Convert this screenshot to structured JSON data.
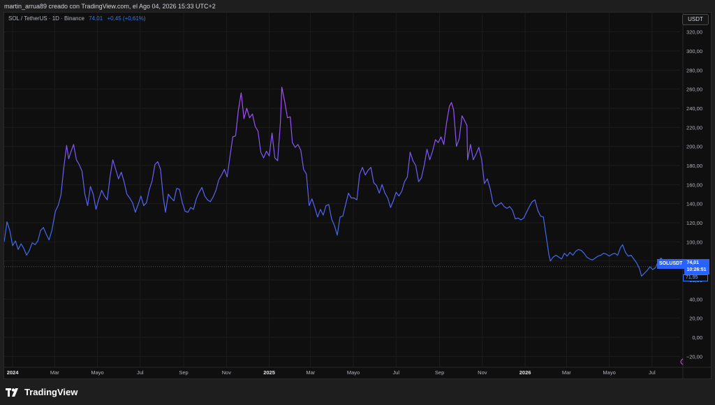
{
  "caption": "martin_arrua89 creado con TradingView.com, el Ago 04, 2026 15:33 UTC+2",
  "legend": {
    "symbol": "SOL / TetherUS · 1D · Binance",
    "price": "74,01",
    "change": "+0,45 (+0,61%)"
  },
  "currency_button": "USDT",
  "price_tag": {
    "symbol": "SOLUSDT",
    "price": "74,01",
    "countdown": "10:26:51",
    "low": "71,95"
  },
  "logo_text": "TradingView",
  "colors": {
    "background": "#0f0f0f",
    "line_low": "#3b6cf0",
    "line_high": "#a64dff",
    "accent": "#2962ff"
  },
  "chart_data": {
    "type": "line",
    "ylim": [
      -30,
      330
    ],
    "y_ticks": [
      -20,
      0,
      20,
      40,
      60,
      80,
      100,
      120,
      140,
      160,
      180,
      200,
      220,
      240,
      260,
      280,
      300,
      320
    ],
    "y_tick_labels": [
      "−20,00",
      "0,00",
      "20,00",
      "40,00",
      "60,00",
      "80,00",
      "100,00",
      "120,00",
      "140,00",
      "160,00",
      "180,00",
      "200,00",
      "220,00",
      "240,00",
      "260,00",
      "280,00",
      "300,00",
      "320,00"
    ],
    "x_labels": [
      {
        "label": "2024",
        "date": "2024-01-01",
        "bold": true
      },
      {
        "label": "Mar",
        "date": "2024-03-01",
        "bold": false
      },
      {
        "label": "Mayo",
        "date": "2024-05-01",
        "bold": false
      },
      {
        "label": "Jul",
        "date": "2024-07-01",
        "bold": false
      },
      {
        "label": "Sep",
        "date": "2024-09-01",
        "bold": false
      },
      {
        "label": "Nov",
        "date": "2024-11-01",
        "bold": false
      },
      {
        "label": "2025",
        "date": "2025-01-01",
        "bold": true
      },
      {
        "label": "Mar",
        "date": "2025-03-01",
        "bold": false
      },
      {
        "label": "Mayo",
        "date": "2025-05-01",
        "bold": false
      },
      {
        "label": "Jul",
        "date": "2025-07-01",
        "bold": false
      },
      {
        "label": "Sep",
        "date": "2025-09-01",
        "bold": false
      },
      {
        "label": "Nov",
        "date": "2025-11-01",
        "bold": false
      },
      {
        "label": "2026",
        "date": "2026-01-01",
        "bold": true
      },
      {
        "label": "Mar",
        "date": "2026-03-01",
        "bold": false
      },
      {
        "label": "Mayo",
        "date": "2026-05-01",
        "bold": false
      },
      {
        "label": "Jul",
        "date": "2026-07-01",
        "bold": false
      }
    ],
    "x_range": [
      "2023-12-20",
      "2026-08-10"
    ],
    "last_price": 74.01,
    "series": [
      {
        "points": [
          [
            "2023-12-20",
            100
          ],
          [
            "2023-12-24",
            121
          ],
          [
            "2023-12-28",
            112
          ],
          [
            "2024-01-01",
            96
          ],
          [
            "2024-01-05",
            101
          ],
          [
            "2024-01-09",
            92
          ],
          [
            "2024-01-13",
            98
          ],
          [
            "2024-01-17",
            93
          ],
          [
            "2024-01-21",
            86
          ],
          [
            "2024-01-25",
            91
          ],
          [
            "2024-01-29",
            99
          ],
          [
            "2024-02-02",
            97
          ],
          [
            "2024-02-06",
            101
          ],
          [
            "2024-02-10",
            112
          ],
          [
            "2024-02-14",
            115
          ],
          [
            "2024-02-18",
            108
          ],
          [
            "2024-02-22",
            102
          ],
          [
            "2024-02-26",
            112
          ],
          [
            "2024-03-02",
            132
          ],
          [
            "2024-03-06",
            138
          ],
          [
            "2024-03-10",
            149
          ],
          [
            "2024-03-14",
            178
          ],
          [
            "2024-03-18",
            201
          ],
          [
            "2024-03-21",
            187
          ],
          [
            "2024-03-24",
            194
          ],
          [
            "2024-03-28",
            202
          ],
          [
            "2024-04-01",
            186
          ],
          [
            "2024-04-05",
            181
          ],
          [
            "2024-04-09",
            174
          ],
          [
            "2024-04-13",
            150
          ],
          [
            "2024-04-17",
            138
          ],
          [
            "2024-04-21",
            158
          ],
          [
            "2024-04-25",
            150
          ],
          [
            "2024-04-29",
            134
          ],
          [
            "2024-05-03",
            145
          ],
          [
            "2024-05-07",
            154
          ],
          [
            "2024-05-11",
            148
          ],
          [
            "2024-05-15",
            144
          ],
          [
            "2024-05-19",
            168
          ],
          [
            "2024-05-23",
            186
          ],
          [
            "2024-05-27",
            176
          ],
          [
            "2024-05-31",
            166
          ],
          [
            "2024-06-04",
            173
          ],
          [
            "2024-06-08",
            163
          ],
          [
            "2024-06-12",
            150
          ],
          [
            "2024-06-16",
            146
          ],
          [
            "2024-06-20",
            141
          ],
          [
            "2024-06-24",
            131
          ],
          [
            "2024-06-28",
            139
          ],
          [
            "2024-07-02",
            148
          ],
          [
            "2024-07-06",
            138
          ],
          [
            "2024-07-10",
            141
          ],
          [
            "2024-07-14",
            155
          ],
          [
            "2024-07-18",
            164
          ],
          [
            "2024-07-22",
            181
          ],
          [
            "2024-07-26",
            184
          ],
          [
            "2024-07-30",
            176
          ],
          [
            "2024-08-03",
            146
          ],
          [
            "2024-08-06",
            131
          ],
          [
            "2024-08-10",
            150
          ],
          [
            "2024-08-14",
            146
          ],
          [
            "2024-08-18",
            143
          ],
          [
            "2024-08-22",
            156
          ],
          [
            "2024-08-26",
            155
          ],
          [
            "2024-08-30",
            141
          ],
          [
            "2024-09-03",
            132
          ],
          [
            "2024-09-07",
            131
          ],
          [
            "2024-09-11",
            136
          ],
          [
            "2024-09-15",
            134
          ],
          [
            "2024-09-19",
            145
          ],
          [
            "2024-09-23",
            152
          ],
          [
            "2024-09-27",
            157
          ],
          [
            "2024-10-01",
            148
          ],
          [
            "2024-10-05",
            144
          ],
          [
            "2024-10-09",
            142
          ],
          [
            "2024-10-13",
            147
          ],
          [
            "2024-10-17",
            154
          ],
          [
            "2024-10-21",
            165
          ],
          [
            "2024-10-25",
            170
          ],
          [
            "2024-10-29",
            176
          ],
          [
            "2024-11-02",
            168
          ],
          [
            "2024-11-06",
            189
          ],
          [
            "2024-11-10",
            210
          ],
          [
            "2024-11-14",
            211
          ],
          [
            "2024-11-18",
            238
          ],
          [
            "2024-11-22",
            256
          ],
          [
            "2024-11-26",
            229
          ],
          [
            "2024-11-30",
            240
          ],
          [
            "2024-12-04",
            230
          ],
          [
            "2024-12-08",
            234
          ],
          [
            "2024-12-12",
            221
          ],
          [
            "2024-12-16",
            216
          ],
          [
            "2024-12-20",
            194
          ],
          [
            "2024-12-24",
            188
          ],
          [
            "2024-12-28",
            195
          ],
          [
            "2025-01-01",
            190
          ],
          [
            "2025-01-05",
            214
          ],
          [
            "2025-01-09",
            188
          ],
          [
            "2025-01-13",
            185
          ],
          [
            "2025-01-17",
            225
          ],
          [
            "2025-01-19",
            262
          ],
          [
            "2025-01-23",
            247
          ],
          [
            "2025-01-27",
            230
          ],
          [
            "2025-01-31",
            231
          ],
          [
            "2025-02-03",
            204
          ],
          [
            "2025-02-07",
            199
          ],
          [
            "2025-02-11",
            202
          ],
          [
            "2025-02-15",
            196
          ],
          [
            "2025-02-19",
            176
          ],
          [
            "2025-02-23",
            171
          ],
          [
            "2025-02-27",
            138
          ],
          [
            "2025-03-03",
            145
          ],
          [
            "2025-03-07",
            136
          ],
          [
            "2025-03-11",
            126
          ],
          [
            "2025-03-15",
            134
          ],
          [
            "2025-03-19",
            128
          ],
          [
            "2025-03-23",
            138
          ],
          [
            "2025-03-27",
            139
          ],
          [
            "2025-03-31",
            124
          ],
          [
            "2025-04-04",
            117
          ],
          [
            "2025-04-08",
            107
          ],
          [
            "2025-04-12",
            126
          ],
          [
            "2025-04-16",
            127
          ],
          [
            "2025-04-20",
            139
          ],
          [
            "2025-04-24",
            151
          ],
          [
            "2025-04-28",
            146
          ],
          [
            "2025-05-02",
            146
          ],
          [
            "2025-05-06",
            144
          ],
          [
            "2025-05-10",
            171
          ],
          [
            "2025-05-14",
            178
          ],
          [
            "2025-05-18",
            170
          ],
          [
            "2025-05-22",
            175
          ],
          [
            "2025-05-26",
            178
          ],
          [
            "2025-05-30",
            162
          ],
          [
            "2025-06-03",
            159
          ],
          [
            "2025-06-07",
            151
          ],
          [
            "2025-06-11",
            160
          ],
          [
            "2025-06-15",
            151
          ],
          [
            "2025-06-19",
            146
          ],
          [
            "2025-06-23",
            136
          ],
          [
            "2025-06-27",
            143
          ],
          [
            "2025-07-01",
            152
          ],
          [
            "2025-07-05",
            148
          ],
          [
            "2025-07-09",
            153
          ],
          [
            "2025-07-13",
            163
          ],
          [
            "2025-07-17",
            168
          ],
          [
            "2025-07-21",
            194
          ],
          [
            "2025-07-25",
            185
          ],
          [
            "2025-07-29",
            180
          ],
          [
            "2025-08-02",
            163
          ],
          [
            "2025-08-06",
            167
          ],
          [
            "2025-08-10",
            180
          ],
          [
            "2025-08-14",
            197
          ],
          [
            "2025-08-18",
            186
          ],
          [
            "2025-08-22",
            195
          ],
          [
            "2025-08-26",
            207
          ],
          [
            "2025-08-30",
            204
          ],
          [
            "2025-09-03",
            210
          ],
          [
            "2025-09-07",
            202
          ],
          [
            "2025-09-11",
            225
          ],
          [
            "2025-09-15",
            242
          ],
          [
            "2025-09-18",
            246
          ],
          [
            "2025-09-21",
            238
          ],
          [
            "2025-09-25",
            200
          ],
          [
            "2025-09-29",
            208
          ],
          [
            "2025-10-03",
            232
          ],
          [
            "2025-10-06",
            228
          ],
          [
            "2025-10-10",
            222
          ],
          [
            "2025-10-11",
            186
          ],
          [
            "2025-10-15",
            202
          ],
          [
            "2025-10-19",
            186
          ],
          [
            "2025-10-23",
            192
          ],
          [
            "2025-10-27",
            199
          ],
          [
            "2025-10-31",
            186
          ],
          [
            "2025-11-04",
            161
          ],
          [
            "2025-11-08",
            166
          ],
          [
            "2025-11-12",
            156
          ],
          [
            "2025-11-16",
            141
          ],
          [
            "2025-11-20",
            137
          ],
          [
            "2025-11-24",
            139
          ],
          [
            "2025-11-28",
            141
          ],
          [
            "2025-12-02",
            137
          ],
          [
            "2025-12-06",
            135
          ],
          [
            "2025-12-10",
            137
          ],
          [
            "2025-12-14",
            133
          ],
          [
            "2025-12-18",
            124
          ],
          [
            "2025-12-22",
            125
          ],
          [
            "2025-12-26",
            123
          ],
          [
            "2025-12-30",
            125
          ],
          [
            "2026-01-03",
            131
          ],
          [
            "2026-01-07",
            137
          ],
          [
            "2026-01-11",
            142
          ],
          [
            "2026-01-15",
            144
          ],
          [
            "2026-01-19",
            133
          ],
          [
            "2026-01-23",
            127
          ],
          [
            "2026-01-27",
            126
          ],
          [
            "2026-01-31",
            106
          ],
          [
            "2026-02-04",
            86
          ],
          [
            "2026-02-06",
            80
          ],
          [
            "2026-02-10",
            84
          ],
          [
            "2026-02-14",
            86
          ],
          [
            "2026-02-18",
            84
          ],
          [
            "2026-02-22",
            82
          ],
          [
            "2026-02-26",
            88
          ],
          [
            "2026-03-02",
            85
          ],
          [
            "2026-03-06",
            89
          ],
          [
            "2026-03-10",
            86
          ],
          [
            "2026-03-14",
            90
          ],
          [
            "2026-03-18",
            92
          ],
          [
            "2026-03-22",
            91
          ],
          [
            "2026-03-26",
            88
          ],
          [
            "2026-03-30",
            84
          ],
          [
            "2026-04-03",
            82
          ],
          [
            "2026-04-07",
            81
          ],
          [
            "2026-04-11",
            83
          ],
          [
            "2026-04-15",
            85
          ],
          [
            "2026-04-19",
            86
          ],
          [
            "2026-04-23",
            88
          ],
          [
            "2026-04-27",
            87
          ],
          [
            "2026-05-01",
            85
          ],
          [
            "2026-05-05",
            87
          ],
          [
            "2026-05-09",
            88
          ],
          [
            "2026-05-13",
            86
          ],
          [
            "2026-05-17",
            94
          ],
          [
            "2026-05-20",
            97
          ],
          [
            "2026-05-24",
            89
          ],
          [
            "2026-05-28",
            85
          ],
          [
            "2026-06-01",
            86
          ],
          [
            "2026-06-05",
            82
          ],
          [
            "2026-06-09",
            78
          ],
          [
            "2026-06-13",
            72
          ],
          [
            "2026-06-16",
            64
          ],
          [
            "2026-06-20",
            67
          ],
          [
            "2026-06-24",
            70
          ],
          [
            "2026-06-28",
            74
          ],
          [
            "2026-07-02",
            71
          ],
          [
            "2026-07-06",
            73
          ],
          [
            "2026-07-10",
            80
          ],
          [
            "2026-07-14",
            83
          ],
          [
            "2026-07-18",
            79
          ],
          [
            "2026-07-22",
            80
          ],
          [
            "2026-07-26",
            76
          ],
          [
            "2026-07-30",
            78
          ],
          [
            "2026-08-02",
            75
          ],
          [
            "2026-08-04",
            74
          ]
        ]
      }
    ]
  }
}
